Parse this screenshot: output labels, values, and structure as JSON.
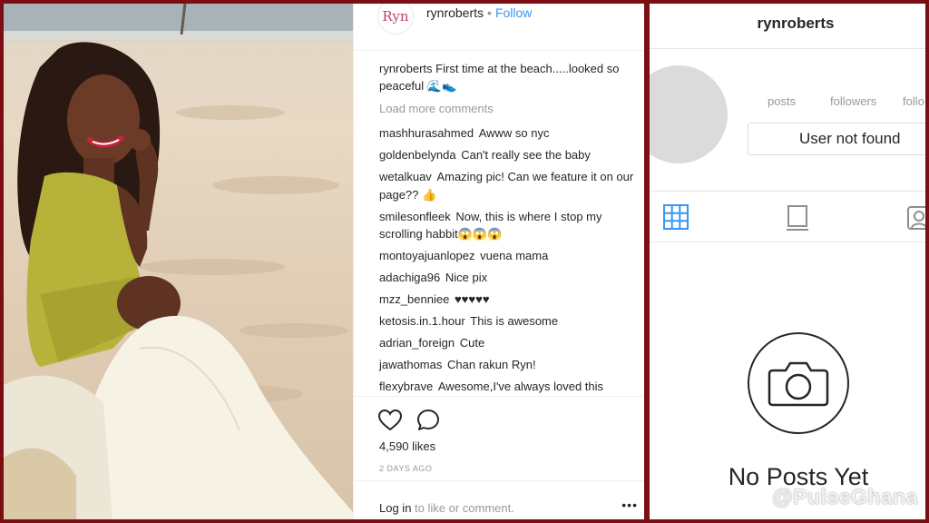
{
  "post": {
    "logo_text": "Ryn",
    "username": "rynroberts",
    "separator": "•",
    "follow_label": "Follow",
    "caption_user": "rynroberts",
    "caption_text": "First time at the beach.....looked so peaceful 🌊👟",
    "load_more": "Load more comments",
    "comments": [
      {
        "user": "mashhurasahmed",
        "text": "Awww so nyc"
      },
      {
        "user": "goldenbelynda",
        "text": "Can't really see the baby"
      },
      {
        "user": "wetalkuav",
        "text": "Amazing pic! Can we feature it on our page?? 👍"
      },
      {
        "user": "smilesonfleek",
        "text": "Now, this is where I stop my scrolling habbit😱😱😱"
      },
      {
        "user": "montoyajuanlopez",
        "text": "vuena mama"
      },
      {
        "user": "adachiga96",
        "text": "Nice pix"
      },
      {
        "user": "mzz_benniee",
        "text": "♥♥♥♥♥"
      },
      {
        "user": "ketosis.in.1.hour",
        "text": "This is awesome"
      },
      {
        "user": "adrian_foreign",
        "text": "Cute"
      },
      {
        "user": "jawathomas",
        "text": "Chan rakun Ryn!"
      },
      {
        "user": "flexybrave",
        "text": "Awesome,I've always loved this"
      }
    ],
    "likes": "4,590 likes",
    "time_ago": "2 DAYS AGO",
    "login_link": "Log in",
    "login_rest": " to like or comment.",
    "more_label": "•••"
  },
  "profile": {
    "title": "rynroberts",
    "stats": [
      "posts",
      "followers",
      "follo"
    ],
    "user_not_found": "User not found",
    "no_posts": "No Posts Yet",
    "watermark": "@PulseGhana"
  },
  "colors": {
    "border": "#7a0e12",
    "link_blue": "#3897f0",
    "grid_icon_blue": "#3897f0",
    "muted": "#999999"
  },
  "icons": [
    "heart-icon",
    "comment-icon",
    "grid-icon",
    "list-icon",
    "tagged-icon",
    "camera-icon"
  ]
}
